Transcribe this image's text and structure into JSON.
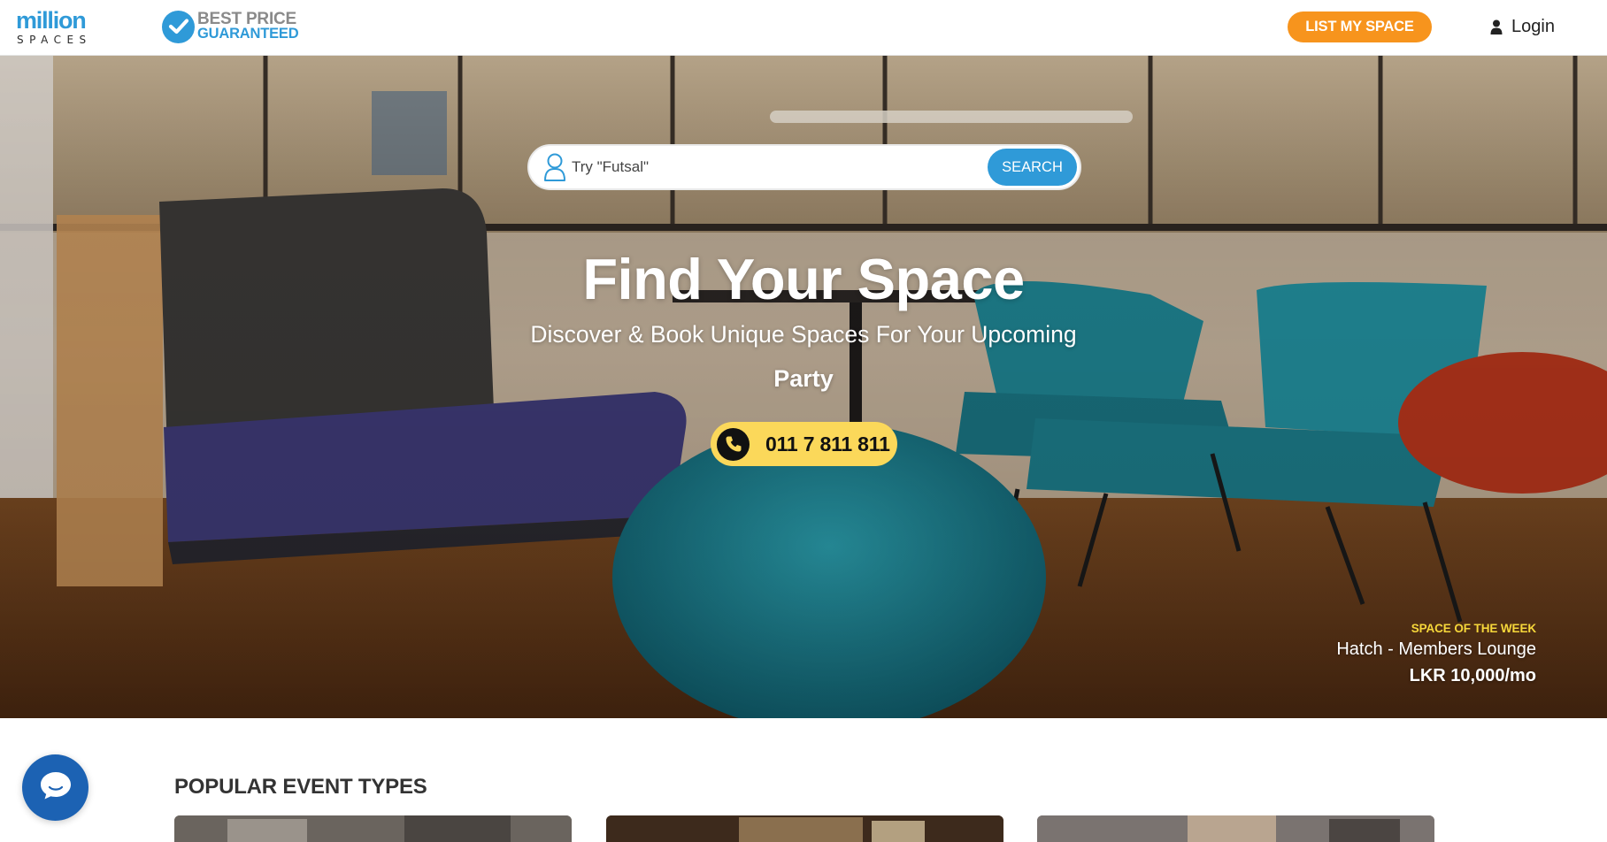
{
  "header": {
    "logo_top": "million",
    "logo_bottom": "SPACES",
    "guarantee_line1": "BEST PRICE",
    "guarantee_line2": "GUARANTEED",
    "list_space_label": "LIST MY SPACE",
    "login_label": "Login"
  },
  "hero": {
    "search": {
      "placeholder": "Try \"Futsal\"",
      "button_label": "SEARCH"
    },
    "title": "Find Your Space",
    "subtitle": "Discover & Book Unique Spaces For Your Upcoming",
    "keyword": "Party",
    "phone": "011 7 811 811",
    "space_of_week": {
      "label": "SPACE OF THE WEEK",
      "name": "Hatch - Members Lounge",
      "price": "LKR 10,000/mo"
    }
  },
  "sections": {
    "popular_title": "POPULAR EVENT TYPES"
  },
  "colors": {
    "brand_blue": "#2f9ad8",
    "accent_orange": "#f7941d",
    "phone_yellow": "#fbd85a",
    "sotw_yellow": "#f6d73a",
    "chat_blue": "#1c62b3"
  },
  "icons": {
    "guarantee": "check-badge-icon",
    "login": "user-icon",
    "search": "person-outline-icon",
    "phone": "phone-icon",
    "chat": "chat-icon"
  }
}
